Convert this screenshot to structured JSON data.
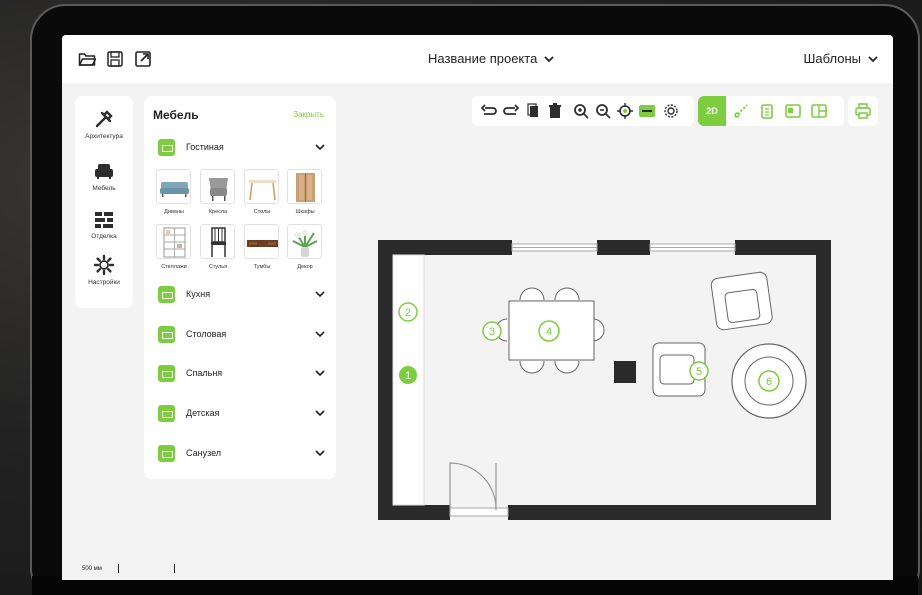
{
  "header": {
    "project_title": "Название проекта",
    "templates_label": "Шаблоны"
  },
  "leftnav": {
    "items": [
      {
        "label": "Архитектура",
        "icon": "tools-icon"
      },
      {
        "label": "Мебель",
        "icon": "sofa-icon"
      },
      {
        "label": "Отделка",
        "icon": "bricks-icon"
      },
      {
        "label": "Настройки",
        "icon": "gear-icon"
      }
    ]
  },
  "panel": {
    "title": "Мебель",
    "close_label": "Закрыть",
    "categories": [
      {
        "label": "Гостиная",
        "expanded": true
      },
      {
        "label": "Кухня"
      },
      {
        "label": "Столовая"
      },
      {
        "label": "Спальня"
      },
      {
        "label": "Детская"
      },
      {
        "label": "Санузел"
      }
    ],
    "living_items": [
      "Диваны",
      "Кресла",
      "Столы",
      "Шкафы",
      "Стеллажи",
      "Стулья",
      "Тумбы",
      "Декор"
    ]
  },
  "toolbar": {
    "view_2d_label": "2D"
  },
  "plan": {
    "markers": [
      "2",
      "1",
      "3",
      "4",
      "5",
      "6"
    ]
  },
  "scale": {
    "label": "500 мм"
  },
  "colors": {
    "accent": "#7ccd3f",
    "wall": "#2a2a2a",
    "background": "#f3f3f3"
  }
}
